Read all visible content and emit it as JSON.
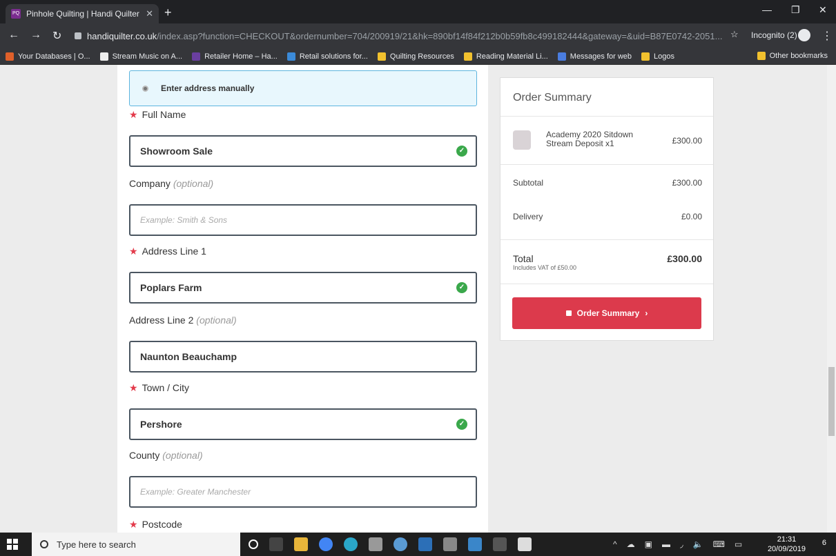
{
  "browser": {
    "tab_title": "Pinhole Quilting | Handi Quilter L",
    "tab_favicon_text": "PQ",
    "url_host": "handiquilter.co.uk",
    "url_path": "/index.asp?function=CHECKOUT&ordernumber=704/200919/21&hk=890bf14f84f212b0b59fb8c499182444&gateway=&uid=B87E0742-2051...",
    "incognito_label": "Incognito (2)",
    "bookmarks": [
      {
        "label": "Your Databases | O...",
        "color": "#e0602a"
      },
      {
        "label": "Stream Music on A...",
        "color": "#eeeeee"
      },
      {
        "label": "Retailer Home – Ha...",
        "color": "#6a3fa0"
      },
      {
        "label": "Retail solutions for...",
        "color": "#3b8ad8"
      },
      {
        "label": "Quilting Resources",
        "color": "#f2c12e"
      },
      {
        "label": "Reading Material Li...",
        "color": "#f2c12e"
      },
      {
        "label": "Messages for web",
        "color": "#4a7de0"
      },
      {
        "label": "Logos",
        "color": "#f2c12e"
      }
    ],
    "other_bookmarks": "Other bookmarks"
  },
  "form": {
    "manual_address": "Enter address manually",
    "fields": [
      {
        "label": "Full Name",
        "required": "★",
        "optional": "",
        "value": "Showroom Sale",
        "placeholder": "",
        "valid": "✓"
      },
      {
        "label": "Company",
        "required": "",
        "optional": "(optional)",
        "value": "",
        "placeholder": "Example: Smith & Sons",
        "valid": ""
      },
      {
        "label": "Address Line 1",
        "required": "★",
        "optional": "",
        "value": "Poplars Farm",
        "placeholder": "",
        "valid": "✓"
      },
      {
        "label": "Address Line 2",
        "required": "",
        "optional": "(optional)",
        "value": "Naunton Beauchamp",
        "placeholder": "",
        "valid": ""
      },
      {
        "label": "Town / City",
        "required": "★",
        "optional": "",
        "value": "Pershore",
        "placeholder": "",
        "valid": "✓"
      },
      {
        "label": "County",
        "required": "",
        "optional": "(optional)",
        "value": "",
        "placeholder": "Example: Greater Manchester",
        "valid": ""
      },
      {
        "label": "Postcode",
        "required": "★",
        "optional": "",
        "value": "",
        "placeholder": "",
        "valid": ""
      }
    ]
  },
  "summary": {
    "title": "Order Summary",
    "item_name": "Academy 2020 Sitdown Stream Deposit x1",
    "item_price": "£300.00",
    "subtotal_label": "Subtotal",
    "subtotal": "£300.00",
    "delivery_label": "Delivery",
    "delivery": "£0.00",
    "total_label": "Total",
    "vat_note": "Includes VAT of £50.00",
    "total": "£300.00",
    "button": "Order Summary",
    "button_color": "#dc3a4c"
  },
  "taskbar": {
    "search_placeholder": "Type here to search",
    "time": "21:31",
    "date": "20/09/2019",
    "notifications": "6"
  }
}
